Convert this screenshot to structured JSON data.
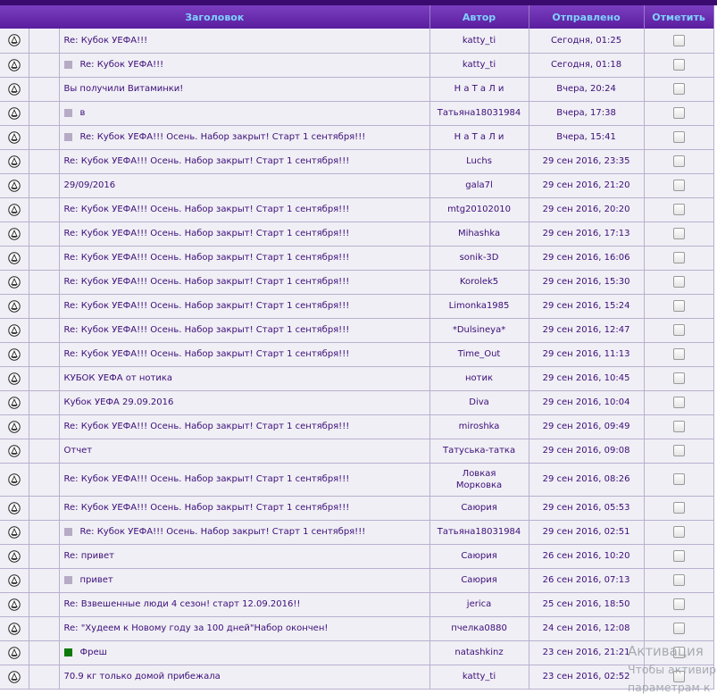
{
  "header": {
    "title": "Заголовок",
    "author": "Автор",
    "sent": "Отправлено",
    "mark": "Отметить"
  },
  "rows": [
    {
      "title": "Re: Кубок УЕФА!!!",
      "author": "katty_ti",
      "date": "Сегодня, 01:25",
      "icon": "none"
    },
    {
      "title": "Re: Кубок УЕФА!!!",
      "author": "katty_ti",
      "date": "Сегодня, 01:18",
      "icon": "grey"
    },
    {
      "title": "Вы получили Витаминки!",
      "author": "Н а Т а Л и",
      "date": "Вчера, 20:24",
      "icon": "none"
    },
    {
      "title": "в",
      "author": "Татьяна18031984",
      "date": "Вчера, 17:38",
      "icon": "grey"
    },
    {
      "title": "Re: Кубок УЕФА!!! Осень. Набор закрыт! Старт 1 сентября!!!",
      "author": "Н а Т а Л и",
      "date": "Вчера, 15:41",
      "icon": "grey"
    },
    {
      "title": "Re: Кубок УЕФА!!! Осень. Набор закрыт! Старт 1 сентября!!!",
      "author": "Luchs",
      "date": "29 сен 2016, 23:35",
      "icon": "none"
    },
    {
      "title": "29/09/2016",
      "author": "gala7l",
      "date": "29 сен 2016, 21:20",
      "icon": "none"
    },
    {
      "title": "Re: Кубок УЕФА!!! Осень. Набор закрыт! Старт 1 сентября!!!",
      "author": "mtg20102010",
      "date": "29 сен 2016, 20:20",
      "icon": "none"
    },
    {
      "title": "Re: Кубок УЕФА!!! Осень. Набор закрыт! Старт 1 сентября!!!",
      "author": "Mihashka",
      "date": "29 сен 2016, 17:13",
      "icon": "none"
    },
    {
      "title": "Re: Кубок УЕФА!!! Осень. Набор закрыт! Старт 1 сентября!!!",
      "author": "sonik-3D",
      "date": "29 сен 2016, 16:06",
      "icon": "none"
    },
    {
      "title": "Re: Кубок УЕФА!!! Осень. Набор закрыт! Старт 1 сентября!!!",
      "author": "Korolek5",
      "date": "29 сен 2016, 15:30",
      "icon": "none"
    },
    {
      "title": "Re: Кубок УЕФА!!! Осень. Набор закрыт! Старт 1 сентября!!!",
      "author": "Limonka1985",
      "date": "29 сен 2016, 15:24",
      "icon": "none"
    },
    {
      "title": "Re: Кубок УЕФА!!! Осень. Набор закрыт! Старт 1 сентября!!!",
      "author": "*Dulsineya*",
      "date": "29 сен 2016, 12:47",
      "icon": "none"
    },
    {
      "title": "Re: Кубок УЕФА!!! Осень. Набор закрыт! Старт 1 сентября!!!",
      "author": "Time_Out",
      "date": "29 сен 2016, 11:13",
      "icon": "none"
    },
    {
      "title": "КУБОК УЕФА от нотика",
      "author": "нотик",
      "date": "29 сен 2016, 10:45",
      "icon": "none"
    },
    {
      "title": "Кубок УЕФА 29.09.2016",
      "author": "Diva",
      "date": "29 сен 2016, 10:04",
      "icon": "none"
    },
    {
      "title": "Re: Кубок УЕФА!!! Осень. Набор закрыт! Старт 1 сентября!!!",
      "author": "miroshka",
      "date": "29 сен 2016, 09:49",
      "icon": "none"
    },
    {
      "title": "Отчет",
      "author": "Татуська-татка",
      "date": "29 сен 2016, 09:08",
      "icon": "none"
    },
    {
      "title": "Re: Кубок УЕФА!!! Осень. Набор закрыт! Старт 1 сентября!!!",
      "author": "Ловкая Морковка",
      "date": "29 сен 2016, 08:26",
      "icon": "none",
      "tall": true
    },
    {
      "title": "Re: Кубок УЕФА!!! Осень. Набор закрыт! Старт 1 сентября!!!",
      "author": "Саюрия",
      "date": "29 сен 2016, 05:53",
      "icon": "none"
    },
    {
      "title": "Re: Кубок УЕФА!!! Осень. Набор закрыт! Старт 1 сентября!!!",
      "author": "Татьяна18031984",
      "date": "29 сен 2016, 02:51",
      "icon": "grey"
    },
    {
      "title": "Re: привет",
      "author": "Саюрия",
      "date": "26 сен 2016, 10:20",
      "icon": "none"
    },
    {
      "title": "привет",
      "author": "Саюрия",
      "date": "26 сен 2016, 07:13",
      "icon": "grey"
    },
    {
      "title": "Re: Взвешенные люди 4 сезон! старт 12.09.2016!!",
      "author": "jerica",
      "date": "25 сен 2016, 18:50",
      "icon": "none"
    },
    {
      "title": "Re: \"Худеем к Новому году за 100 дней\"Набор окончен!",
      "author": "пчелка0880",
      "date": "24 сен 2016, 12:08",
      "icon": "none"
    },
    {
      "title": "Фреш",
      "author": "natashkinz",
      "date": "23 сен 2016, 21:21",
      "icon": "green"
    },
    {
      "title": "70.9 кг только домой прибежала",
      "author": "katty_ti",
      "date": "23 сен 2016, 02:52",
      "icon": "none"
    }
  ],
  "watermark": {
    "line1": "Активация",
    "line2": "Чтобы активир",
    "line3": "параметрам к"
  },
  "colors": {
    "header_bg": "#6a2db4",
    "header_text": "#7fd0ff",
    "row_bg": "#f0eff5",
    "link": "#3b0d78",
    "grey_mark": "#b7aac4",
    "green_mark": "#0b7a0b"
  }
}
